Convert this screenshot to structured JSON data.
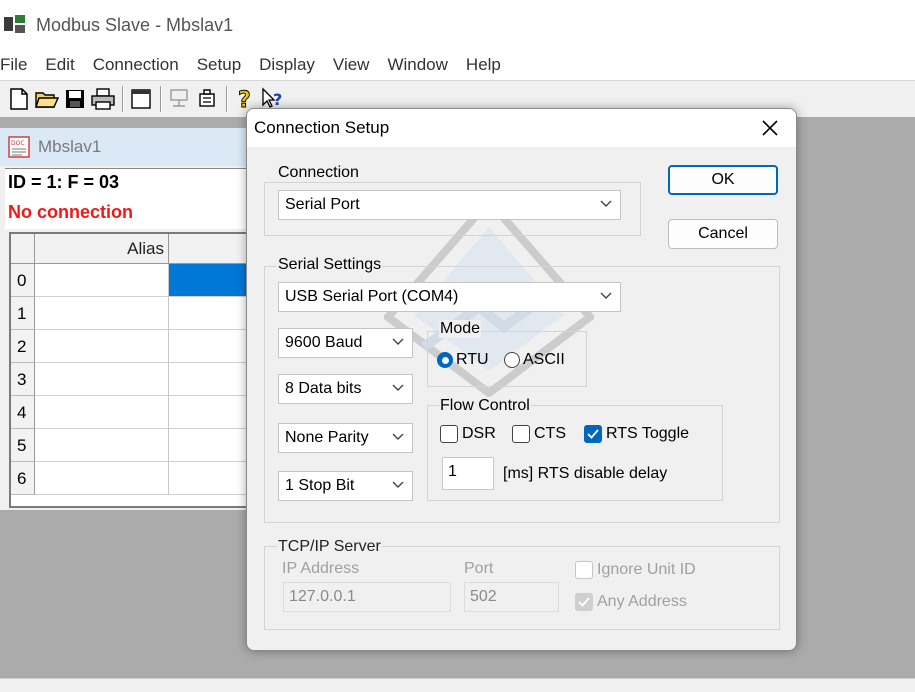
{
  "app": {
    "title": "Modbus Slave - Mbslav1"
  },
  "menu": [
    "File",
    "Edit",
    "Connection",
    "Setup",
    "Display",
    "View",
    "Window",
    "Help"
  ],
  "toolbar": [
    "new-icon",
    "open-icon",
    "save-icon",
    "print-icon",
    "window-icon",
    "comm-icon",
    "device-icon",
    "help-icon",
    "context-help-icon"
  ],
  "child": {
    "title": "Mbslav1",
    "id_line": "ID = 1: F = 03",
    "status": "No connection",
    "grid": {
      "alias_header": "Alias",
      "rows": [
        "0",
        "1",
        "2",
        "3",
        "4",
        "5",
        "6"
      ]
    }
  },
  "dialog": {
    "title": "Connection Setup",
    "ok": "OK",
    "cancel": "Cancel",
    "connection": {
      "label": "Connection",
      "value": "Serial Port"
    },
    "serial": {
      "label": "Serial Settings",
      "port": "USB Serial Port (COM4)",
      "baud": "9600 Baud",
      "data_bits": "8 Data bits",
      "parity": "None Parity",
      "stop_bits": "1 Stop Bit",
      "mode": {
        "label": "Mode",
        "rtu": "RTU",
        "ascii": "ASCII",
        "selected": "RTU"
      },
      "flow": {
        "label": "Flow Control",
        "dsr": "DSR",
        "cts": "CTS",
        "rts_toggle": "RTS Toggle",
        "rts_delay_value": "1",
        "rts_delay_label": "[ms] RTS disable delay"
      }
    },
    "tcp": {
      "label": "TCP/IP Server",
      "ip_label": "IP Address",
      "ip_value": "127.0.0.1",
      "port_label": "Port",
      "port_value": "502",
      "ignore_unit_id": "Ignore Unit ID",
      "any_address": "Any Address"
    }
  },
  "colors": {
    "accent": "#0067c0",
    "error": "#f21818",
    "selection": "#0078d7"
  }
}
